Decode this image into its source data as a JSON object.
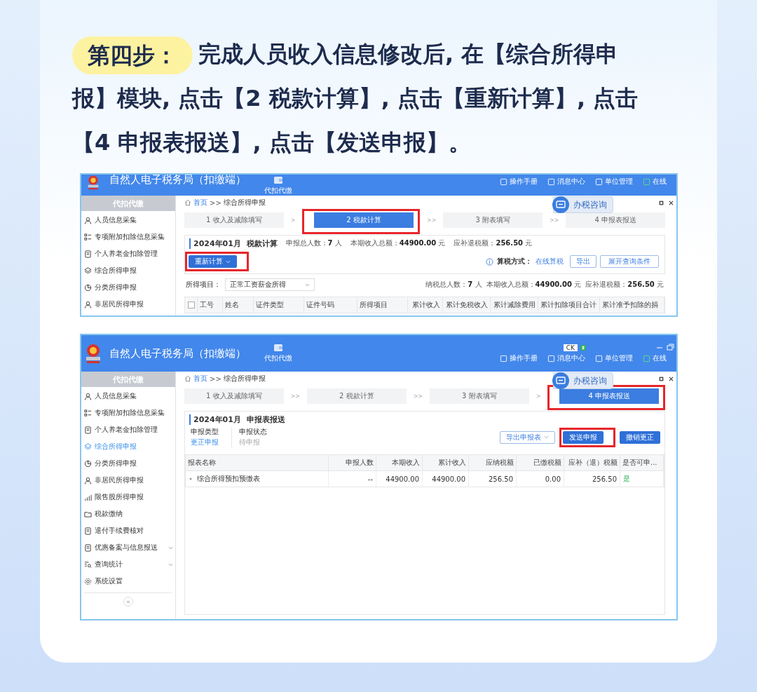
{
  "instruction": {
    "step_label": "第四步：",
    "text": "完成人员收入信息修改后, 在【综合所得申报】模块, 点击【2 税款计算】, 点击【重新计算】, 点击【4 申报表报送】, 点击【发送申报】。"
  },
  "screenshots": [
    {
      "kind": "tax_calculation",
      "cut_at_top": true,
      "header": {
        "app_title": "自然人电子税务局（扣缴端）",
        "nav_item": "代扣代缴",
        "links": [
          "操作手册",
          "消息中心",
          "单位管理",
          "在线"
        ]
      },
      "sidebar": {
        "heading": "代扣代缴",
        "items": [
          {
            "label": "人员信息采集",
            "selected": false,
            "expandable": false
          },
          {
            "label": "专项附加扣除信息采集",
            "selected": false,
            "expandable": false
          },
          {
            "label": "个人养老金扣除管理",
            "selected": false,
            "expandable": false
          },
          {
            "label": "综合所得申报",
            "selected": false,
            "expandable": false
          },
          {
            "label": "分类所得申报",
            "selected": false,
            "expandable": false
          },
          {
            "label": "非居民所得申报",
            "selected": false,
            "expandable": false
          }
        ]
      },
      "breadcrumb": {
        "home": "首页",
        "separator": ">>",
        "current": "综合所得申报"
      },
      "consult_button": "办税咨询",
      "steps": [
        {
          "label": "1 收入及减除填写",
          "selected": false,
          "highlighted": false
        },
        {
          "separator": ">",
          "label": "2 税款计算",
          "selected": true,
          "highlighted": true
        },
        {
          "separator": ">>",
          "label": "3 附表填写",
          "selected": false,
          "highlighted": false
        },
        {
          "separator": ">>",
          "label": "4 申报表报送",
          "selected": false,
          "highlighted": false
        }
      ],
      "panel": {
        "period": "2024年01月",
        "title": "税款计算",
        "stats": [
          {
            "label": "申报总人数：",
            "value": "7",
            "unit": "人"
          },
          {
            "label": "本期收入总额：",
            "value": "44900.00",
            "unit": "元"
          },
          {
            "label": "应补退税额：",
            "value": "256.50",
            "unit": "元"
          }
        ],
        "recalc_button": {
          "label": "重新计算",
          "highlighted": true
        },
        "method_label": "算税方式：",
        "method_value": "在线算税",
        "buttons": [
          "导出",
          "展开查询条件"
        ],
        "filter_label": "所得项目：",
        "filter_value": "正常工资薪金所得",
        "summary": [
          {
            "label": "纳税总人数：",
            "value": "7",
            "unit": "人"
          },
          {
            "label": "本期收入总额：",
            "value": "44900.00",
            "unit": "元"
          },
          {
            "label": "应补退税额：",
            "value": "256.50",
            "unit": "元"
          }
        ],
        "table": {
          "select_all_checked": false,
          "columns": [
            "工号",
            "姓名",
            "证件类型",
            "证件号码",
            "所得项目",
            "累计收入",
            "累计免税收入",
            "累计减除费用",
            "累计扣除项目合计",
            "累计准予扣除的捐"
          ]
        }
      }
    },
    {
      "kind": "report_submission",
      "cut_at_top": false,
      "header": {
        "app_title": "自然人电子税务局（扣缴端）",
        "nav_item": "代扣代缴",
        "input_method": "CK",
        "links": [
          "操作手册",
          "消息中心",
          "单位管理",
          "在线"
        ]
      },
      "sidebar": {
        "heading": "代扣代缴",
        "collapse": "«",
        "items": [
          {
            "label": "人员信息采集",
            "selected": false,
            "expandable": false
          },
          {
            "label": "专项附加扣除信息采集",
            "selected": false,
            "expandable": false
          },
          {
            "label": "个人养老金扣除管理",
            "selected": false,
            "expandable": false
          },
          {
            "label": "综合所得申报",
            "selected": true,
            "expandable": false
          },
          {
            "label": "分类所得申报",
            "selected": false,
            "expandable": false
          },
          {
            "label": "非居民所得申报",
            "selected": false,
            "expandable": false
          },
          {
            "label": "限售股所得申报",
            "selected": false,
            "expandable": false
          },
          {
            "label": "税款缴纳",
            "selected": false,
            "expandable": false
          },
          {
            "label": "退付手续费核对",
            "selected": false,
            "expandable": false
          },
          {
            "label": "优惠备案与信息报送",
            "selected": false,
            "expandable": true
          },
          {
            "label": "查询统计",
            "selected": false,
            "expandable": true
          },
          {
            "label": "系统设置",
            "selected": false,
            "expandable": false
          }
        ]
      },
      "breadcrumb": {
        "home": "首页",
        "separator": ">>",
        "current": "综合所得申报"
      },
      "consult_button": "办税咨询",
      "steps": [
        {
          "label": "1 收入及减除填写",
          "selected": false,
          "highlighted": false
        },
        {
          "separator": ">>",
          "label": "2 税款计算",
          "selected": false,
          "highlighted": false
        },
        {
          "separator": ">>",
          "label": "3 附表填写",
          "selected": false,
          "highlighted": false
        },
        {
          "separator": ">",
          "label": "4 申报表报送",
          "selected": true,
          "highlighted": true
        }
      ],
      "panel": {
        "period": "2024年01月",
        "title": "申报表报送",
        "fields": [
          {
            "label": "申报类型",
            "value": "更正申报",
            "kind": "link"
          },
          {
            "label": "申报状态",
            "value": "待申报",
            "kind": "muted"
          }
        ],
        "buttons": [
          {
            "label": "导出申报表",
            "kind": "dropdown",
            "highlighted": false
          },
          {
            "label": "发送申报",
            "kind": "primary",
            "highlighted": true
          },
          {
            "label": "撤销更正",
            "kind": "primary",
            "highlighted": false
          }
        ],
        "table": {
          "columns": [
            "报表名称",
            "申报人数",
            "本期收入",
            "累计收入",
            "应纳税额",
            "已缴税额",
            "应补（退）税额",
            "是否可申..."
          ],
          "rows": [
            {
              "cells": [
                "综合所得预扣预缴表",
                "--",
                "44900.00",
                "44900.00",
                "256.50",
                "0.00",
                "256.50",
                "是"
              ]
            }
          ]
        }
      }
    }
  ]
}
